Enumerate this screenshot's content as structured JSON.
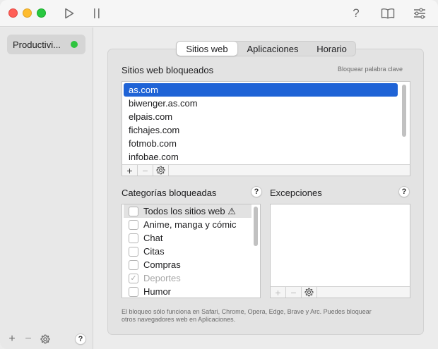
{
  "window": {
    "toolbar_icons": [
      "play-icon",
      "pause-icon",
      "help-icon",
      "book-icon",
      "sliders-icon"
    ],
    "help_glyph": "?"
  },
  "sidebar": {
    "items": [
      {
        "label": "Productivi...",
        "status_color": "#2fc43f"
      }
    ],
    "footer": {
      "add": "+",
      "remove": "−",
      "help": "?"
    }
  },
  "tabs": [
    {
      "label": "Sitios web",
      "active": true
    },
    {
      "label": "Aplicaciones",
      "active": false
    },
    {
      "label": "Horario",
      "active": false
    }
  ],
  "blocked_sites": {
    "title": "Sitios web bloqueados",
    "keyword_link": "Bloquear palabra clave",
    "items": [
      "as.com",
      "biwenger.as.com",
      "elpais.com",
      "fichajes.com",
      "fotmob.com",
      "infobae.com"
    ],
    "selected_index": 0,
    "toolbar": {
      "add": "+",
      "remove": "−"
    }
  },
  "categories": {
    "title": "Categorías bloqueadas",
    "help": "?",
    "items": [
      {
        "label": "Todos los sitios web ⚠",
        "checked": false,
        "disabled": false
      },
      {
        "label": "Anime, manga y cómic",
        "checked": false,
        "disabled": false
      },
      {
        "label": "Chat",
        "checked": false,
        "disabled": false
      },
      {
        "label": "Citas",
        "checked": false,
        "disabled": false
      },
      {
        "label": "Compras",
        "checked": false,
        "disabled": false
      },
      {
        "label": "Deportes",
        "checked": true,
        "disabled": true
      },
      {
        "label": "Humor",
        "checked": false,
        "disabled": false
      }
    ]
  },
  "exceptions": {
    "title": "Excepciones",
    "help": "?",
    "toolbar": {
      "add": "+",
      "remove": "−"
    }
  },
  "footer_note": {
    "line1": "El bloqueo sólo funciona en Safari, Chrome, Opera, Edge, Brave y Arc. Puedes bloquear",
    "line2": "otros navegadores web en Aplicaciones."
  },
  "colors": {
    "accent": "#1f63d6",
    "status_green": "#2fc43f"
  }
}
